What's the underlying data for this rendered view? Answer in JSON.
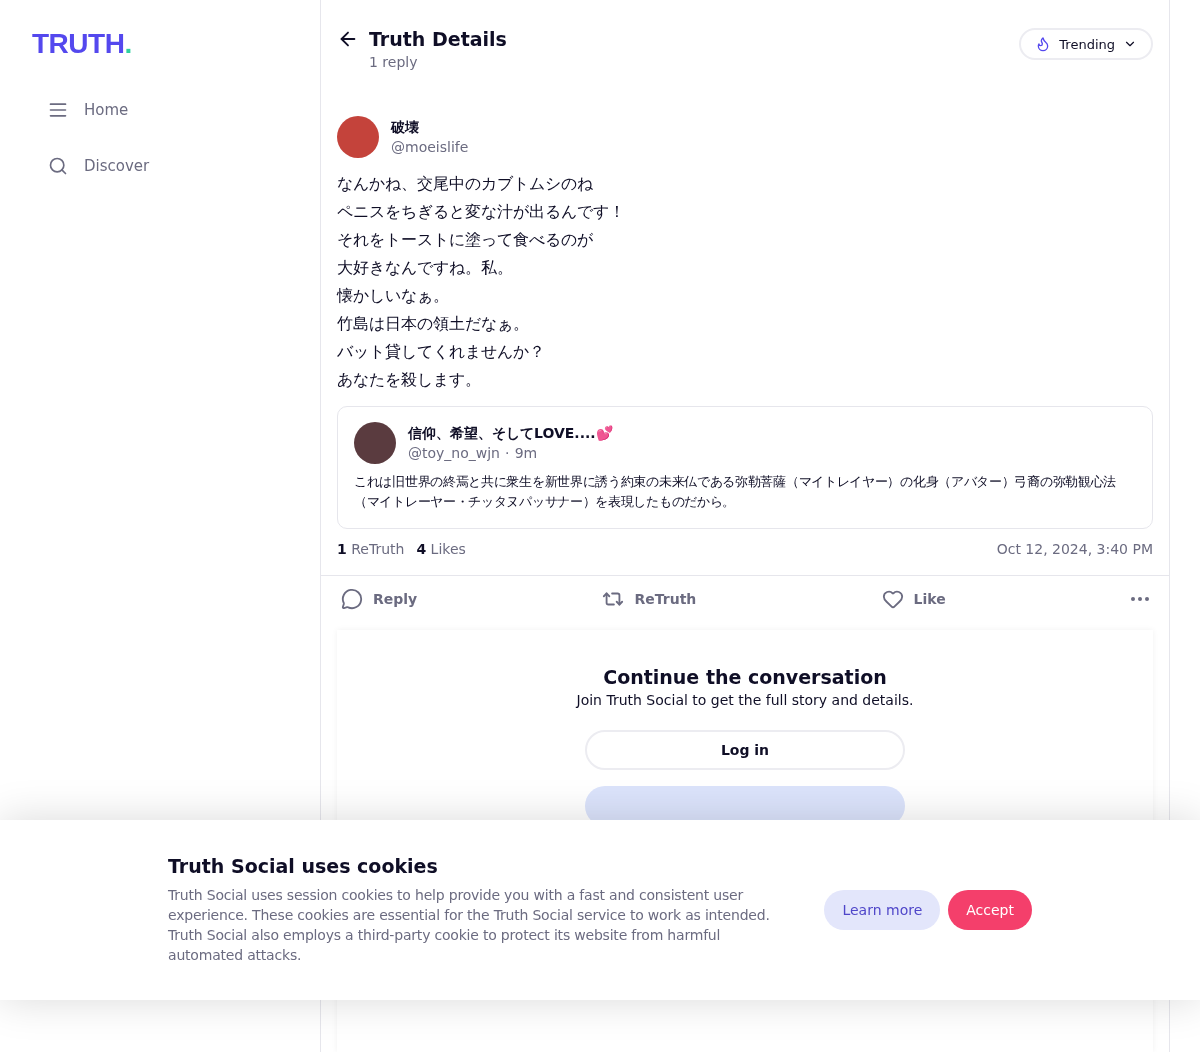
{
  "logo": {
    "text": "TRUTH",
    "dot": "."
  },
  "sidebar": {
    "items": [
      {
        "kind": "home",
        "label": "Home",
        "selected": false
      },
      {
        "kind": "discover",
        "label": "Discover",
        "selected": false
      }
    ]
  },
  "header": {
    "title": "Truth Details",
    "subtitle": "1 reply",
    "sort": {
      "label": "Trending"
    }
  },
  "post": {
    "author": {
      "name": "破壊",
      "handle": "@moeislife"
    },
    "lines": [
      "なんかね、交尾中のカブトムシのね",
      "ペニスをちぎると変な汁が出るんです！",
      "それをトーストに塗って食べるのが",
      "大好きなんですね。私。",
      "懐かしいなぁ。",
      "竹島は日本の領土だなぁ。",
      "バット貸してくれませんか？",
      "あなたを殺します。"
    ],
    "quote": {
      "name": "信仰、希望、そしてLOVE....💕",
      "handle": "@toy_no_wjn",
      "separator": "·",
      "time": "9m",
      "text": "これは旧世界の終焉と共に衆生を新世界に誘う約束の未来仏である弥勒菩薩（マイトレイヤー）の化身（アバター）弓裔の弥勒観心法（マイトレーヤー・チッタヌパッサナー）を表現したものだから。"
    },
    "stats": [
      {
        "count": "1",
        "label": "ReTruth"
      },
      {
        "count": "4",
        "label": "Likes"
      }
    ],
    "date": "Oct 12, 2024, 3:40 PM",
    "actions": [
      {
        "kind": "reply",
        "label": "Reply"
      },
      {
        "kind": "retruth",
        "label": "ReTruth"
      },
      {
        "kind": "like",
        "label": "Like"
      },
      {
        "kind": "more"
      }
    ]
  },
  "signup": {
    "title": "Continue the conversation",
    "text": "Join Truth Social to get the full story and details.",
    "login": "Log in"
  },
  "cookies": {
    "title": "Truth Social uses cookies",
    "text": "Truth Social uses session cookies to help provide you with a fast and consistent user experience. These cookies are essential for the Truth Social service to work as intended. Truth Social also employs a third-party cookie to protect its website from harmful automated attacks.",
    "learn": "Learn more",
    "accept": "Accept"
  }
}
